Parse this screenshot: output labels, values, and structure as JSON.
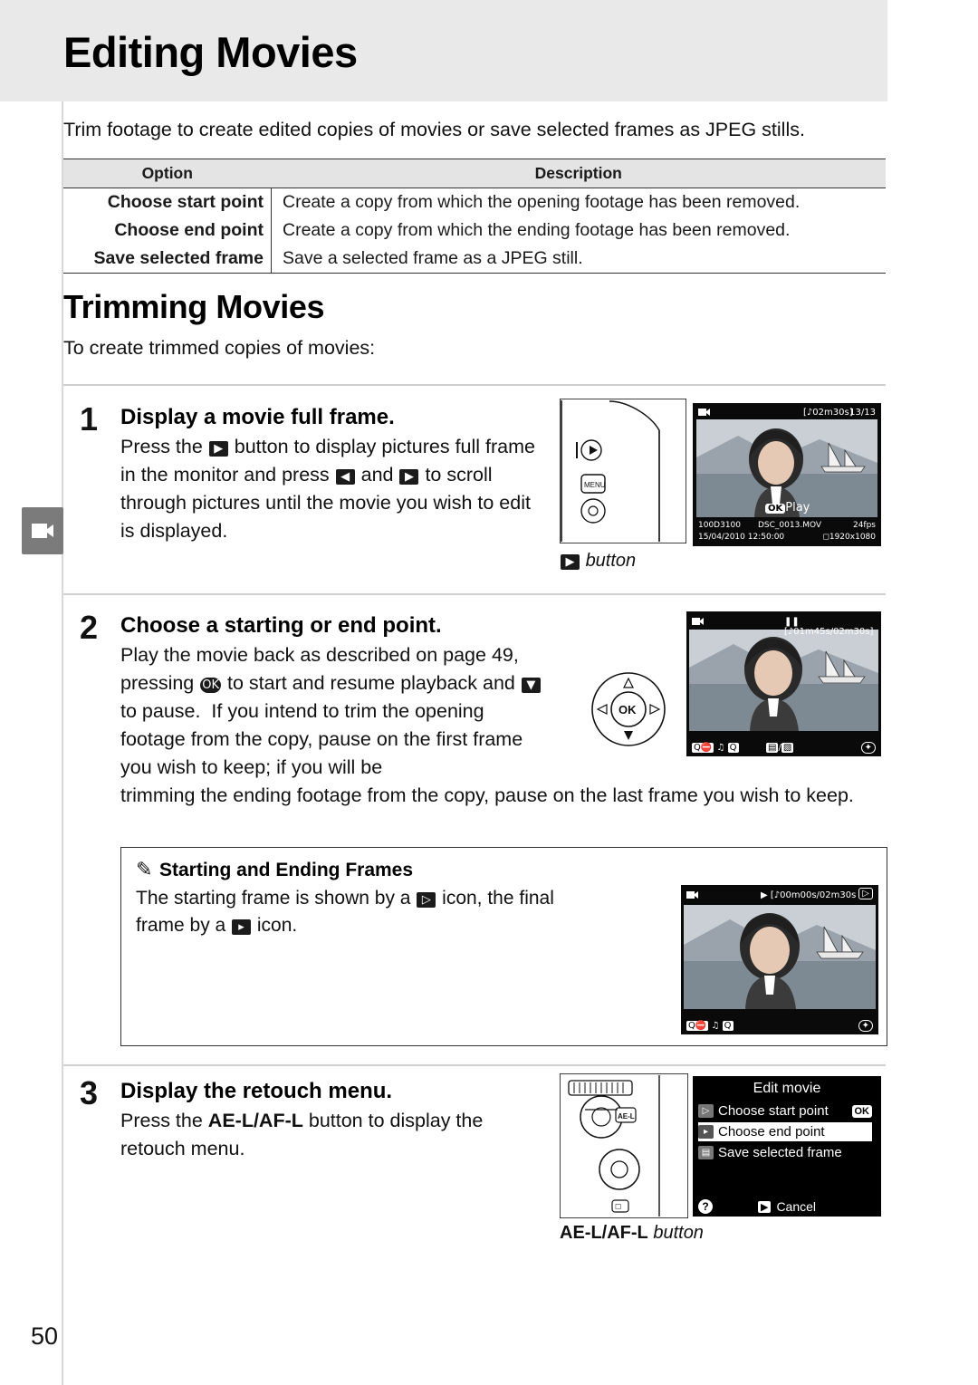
{
  "header": {
    "title": "Editing Movies"
  },
  "intro": "Trim footage to create edited copies of movies or save selected frames as JPEG stills.",
  "options_table": {
    "headers": [
      "Option",
      "Description"
    ],
    "rows": [
      [
        "Choose start point",
        "Create a copy from which the opening footage has been removed."
      ],
      [
        "Choose end point",
        "Create a copy from which the ending footage has been removed."
      ],
      [
        "Save selected frame",
        "Save a selected frame as a JPEG still."
      ]
    ]
  },
  "section": {
    "heading": "Trimming Movies",
    "lead": "To create trimmed copies of movies:"
  },
  "steps": [
    {
      "num": "1",
      "title": "Display a movie full frame.",
      "body_pre": "Press the ",
      "body_mid": " button to display pictures full frame in the monitor and press ",
      "body_mid2": " and ",
      "body_post": " to scroll through pictures until the movie you wish to edit is displayed.",
      "caption": "button"
    },
    {
      "num": "2",
      "title": "Choose a starting or end point.",
      "body": "Play the movie back as described on page 49, pressing J to start and resume playback and 3 to pause. If you intend to trim the opening footage from the copy, pause on the first frame you wish to keep; if you will be trimming the ending footage from the copy, pause on the last frame you wish to keep."
    },
    {
      "num": "3",
      "title": "Display the retouch menu.",
      "body": "Press the AE-L/AF-L button to display the retouch menu.",
      "caption_bold": "AE-L/AF-L",
      "caption_italic": "button"
    }
  ],
  "note": {
    "title": "Starting and Ending Frames",
    "body_pre": "The starting frame is shown by a ",
    "body_mid": " icon, the final frame by a ",
    "body_post": " icon."
  },
  "lcd1": {
    "top_time": "02m30s",
    "frame_count": "13/13",
    "ok_play": "Play",
    "folder": "100D3100",
    "file": "DSC_0013.MOV",
    "fps": "24fps",
    "date": "15/04/2010 12:50:00",
    "size": "1920x1080"
  },
  "lcd2": {
    "top_time": "01m45s/02m30s"
  },
  "lcd3": {
    "top_time": "00m00s/02m30s"
  },
  "menu": {
    "title": "Edit movie",
    "items": [
      {
        "label": "Choose start point",
        "selected": false,
        "ok": "OK"
      },
      {
        "label": "Choose end point",
        "selected": true
      },
      {
        "label": "Save selected frame",
        "selected": false
      }
    ],
    "cancel": "Cancel",
    "help": "?"
  },
  "page_number": "50",
  "icons": {
    "playback": "playback-icon",
    "left": "multi-selector-left-icon",
    "right": "multi-selector-right-icon",
    "start_frame": "start-frame-icon",
    "end_frame": "end-frame-icon"
  }
}
